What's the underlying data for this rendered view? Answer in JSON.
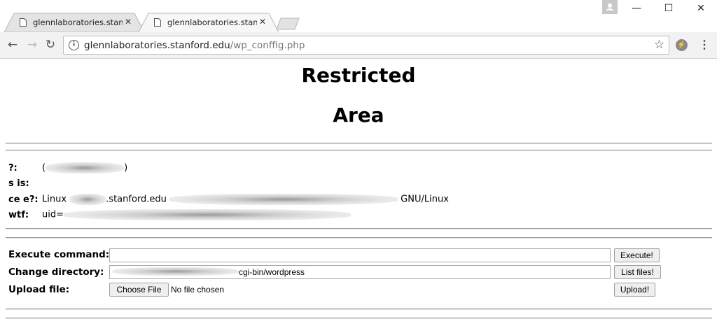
{
  "browser": {
    "tabs": [
      {
        "title": "glennlaboratories.stanfor"
      },
      {
        "title": "glennlaboratories.stanfor"
      }
    ],
    "tab_close": "✕",
    "window_controls": {
      "minimize": "—",
      "maximize": "☐",
      "close": "✕"
    },
    "address": {
      "domain": "glennlaboratories.stanford.edu",
      "path": "/wp_conffig.php"
    },
    "icons": [
      "page-icon",
      "back-arrow-icon",
      "forward-arrow-icon",
      "reload-icon",
      "info-icon",
      "star-icon",
      "extension-icon",
      "menu-icon",
      "profile-icon"
    ]
  },
  "page": {
    "heading_line1": "Restricted",
    "heading_line2": "Area",
    "info": [
      {
        "label": "?:",
        "prefix": "(",
        "suffix": ")"
      },
      {
        "label": "s is:"
      },
      {
        "label": "ce e?:",
        "prefix": "Linux ",
        "mid": ".stanford.edu ",
        "suffix": " GNU/Linux"
      },
      {
        "label": "wtf:",
        "prefix": "uid="
      }
    ],
    "form": {
      "execute_label": "Execute command:",
      "execute_value": "",
      "execute_button": "Execute!",
      "chdir_label": "Change directory:",
      "chdir_value": "cgi-bin/wordpress",
      "chdir_button": "List files!",
      "upload_label": "Upload file:",
      "choose_button": "Choose File",
      "no_file": "No file chosen",
      "upload_button": "Upload!"
    }
  }
}
